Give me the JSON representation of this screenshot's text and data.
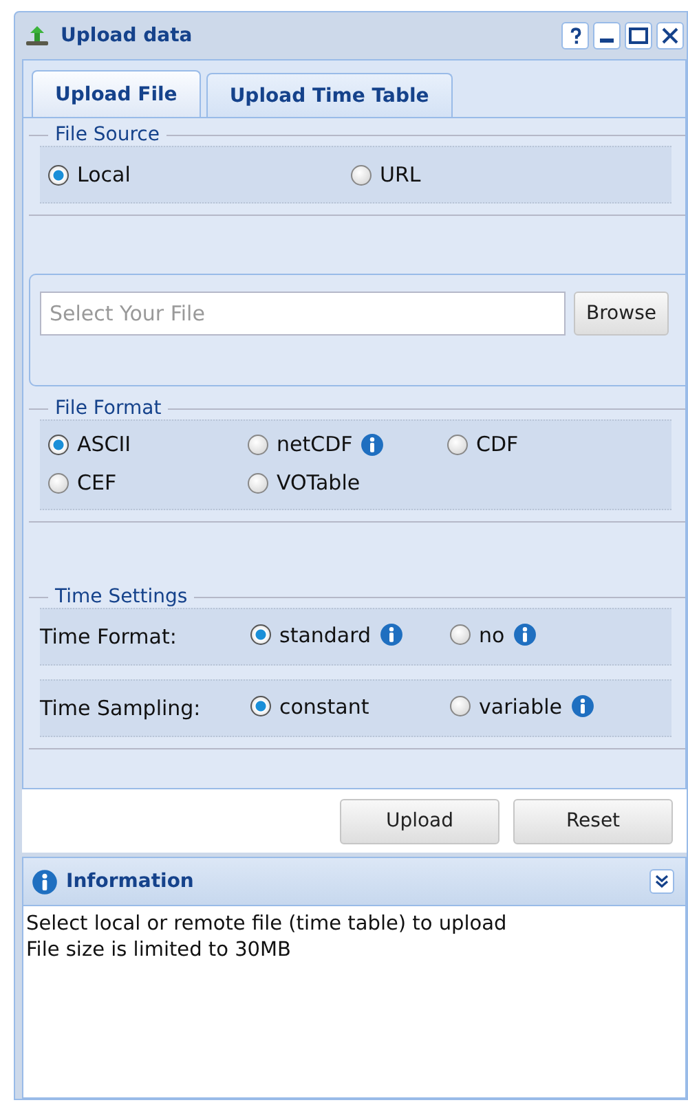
{
  "window": {
    "title": "Upload data"
  },
  "tabs": [
    {
      "label": "Upload File",
      "selected": true
    },
    {
      "label": "Upload Time Table",
      "selected": false
    }
  ],
  "file_source": {
    "legend": "File Source",
    "options": [
      {
        "label": "Local",
        "selected": true,
        "info": false
      },
      {
        "label": "URL",
        "selected": false,
        "info": false
      }
    ]
  },
  "file_field": {
    "placeholder": "Select Your File",
    "button": "Browse"
  },
  "file_format": {
    "legend": "File Format",
    "options": [
      {
        "label": "ASCII",
        "selected": true,
        "info": false
      },
      {
        "label": "netCDF",
        "selected": false,
        "info": true
      },
      {
        "label": "CDF",
        "selected": false,
        "info": false
      },
      {
        "label": "CEF",
        "selected": false,
        "info": false
      },
      {
        "label": "VOTable",
        "selected": false,
        "info": false
      }
    ]
  },
  "time_settings": {
    "legend": "Time Settings",
    "rows": [
      {
        "label": "Time Format:",
        "options": [
          {
            "label": "standard",
            "selected": true,
            "info": true
          },
          {
            "label": "no",
            "selected": false,
            "info": true
          }
        ]
      },
      {
        "label": "Time Sampling:",
        "options": [
          {
            "label": "constant",
            "selected": true,
            "info": false
          },
          {
            "label": "variable",
            "selected": false,
            "info": true
          }
        ]
      }
    ]
  },
  "buttons": [
    "Upload",
    "Reset"
  ],
  "information": {
    "title": "Information",
    "lines": [
      "Select local or remote file (time table) to upload",
      "File size is limited to 30MB"
    ]
  }
}
